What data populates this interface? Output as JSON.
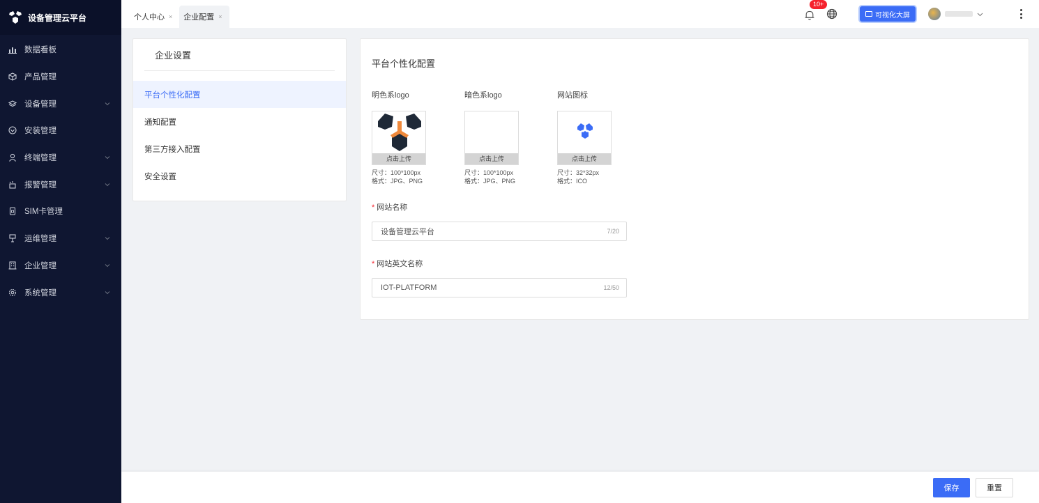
{
  "app": {
    "title": "设备管理云平台"
  },
  "sidebar": {
    "items": [
      {
        "label": "数据看板",
        "icon": "chart-icon",
        "expandable": false
      },
      {
        "label": "产品管理",
        "icon": "cube-icon",
        "expandable": false
      },
      {
        "label": "设备管理",
        "icon": "layers-icon",
        "expandable": true
      },
      {
        "label": "安装管理",
        "icon": "install-icon",
        "expandable": false
      },
      {
        "label": "终端管理",
        "icon": "user-icon",
        "expandable": true
      },
      {
        "label": "报警管理",
        "icon": "alarm-icon",
        "expandable": true
      },
      {
        "label": "SIM卡管理",
        "icon": "sim-icon",
        "expandable": false
      },
      {
        "label": "运维管理",
        "icon": "ops-icon",
        "expandable": true
      },
      {
        "label": "企业管理",
        "icon": "building-icon",
        "expandable": true
      },
      {
        "label": "系统管理",
        "icon": "settings-icon",
        "expandable": true
      }
    ]
  },
  "tabs": [
    {
      "label": "个人中心",
      "close": "×",
      "active": false
    },
    {
      "label": "企业配置",
      "close": "×",
      "active": true
    }
  ],
  "header": {
    "badge": "10+",
    "viz_button": "可视化大屏"
  },
  "settings": {
    "title": "企业设置",
    "items": [
      "平台个性化配置",
      "通知配置",
      "第三方接入配置",
      "安全设置"
    ]
  },
  "content": {
    "title": "平台个性化配置",
    "logos": [
      {
        "label": "明色系logo",
        "upload": "点击上传",
        "size": "尺寸：100*100px",
        "format": "格式：JPG、PNG"
      },
      {
        "label": "暗色系logo",
        "upload": "点击上传",
        "size": "尺寸：100*100px",
        "format": "格式：JPG、PNG"
      },
      {
        "label": "网站图标",
        "upload": "点击上传",
        "size": "尺寸：32*32px",
        "format": "格式：ICO"
      }
    ],
    "site_name": {
      "label": "网站名称",
      "required": "*",
      "value": "设备管理云平台",
      "count": "7/20"
    },
    "site_en_name": {
      "label": "网站英文名称",
      "required": "*",
      "value": "IOT-PLATFORM",
      "count": "12/50"
    }
  },
  "footer": {
    "save": "保存",
    "reset": "重置"
  },
  "colors": {
    "primary": "#3b6cf6",
    "sidebar_bg": "#0f1631",
    "orange": "#f08a3c",
    "dark": "#1f2937"
  }
}
